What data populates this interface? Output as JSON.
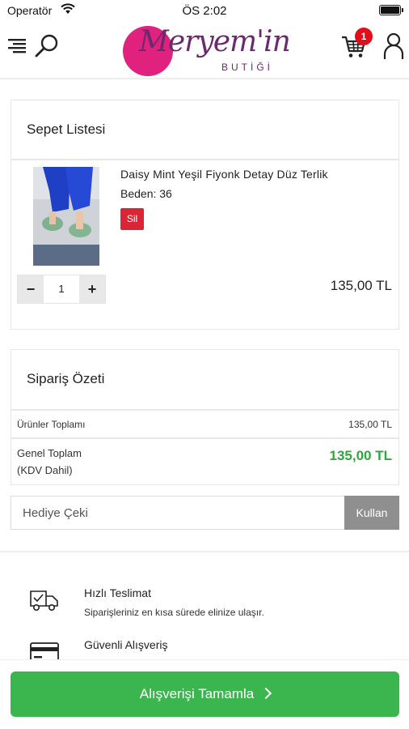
{
  "status_bar": {
    "carrier": "Operatör",
    "time": "ÖS 2:02"
  },
  "header": {
    "logo_script": "Meryem'in",
    "logo_sub": "BUTİĞİ",
    "cart_count": "1",
    "colors": {
      "brand_pink": "#e0227e",
      "brand_purple": "#6b2a6d",
      "badge": "#e10f1b"
    }
  },
  "cart": {
    "title": "Sepet Listesi",
    "items": [
      {
        "name": "Daisy Mint Yeşil Fiyonk Detay Düz Terlik",
        "size": "Beden: 36",
        "delete_label": "Sil",
        "quantity": "1",
        "decrement": "−",
        "increment": "+",
        "price": "135,00 TL"
      }
    ]
  },
  "summary": {
    "title": "Sipariş Özeti",
    "products_total_label": "Ürünler Toplamı",
    "products_total_value": "135,00 TL",
    "grand_total_label": "Genel Toplam",
    "grand_total_note": "(KDV Dahil)",
    "grand_total_value": "135,00 TL"
  },
  "coupon": {
    "placeholder": "Hediye Çeki",
    "button_label": "Kullan"
  },
  "info": [
    {
      "icon": "delivery-icon",
      "title": "Hızlı Teslimat",
      "text": "Siparişleriniz en kısa sürede elinize ulaşır."
    },
    {
      "icon": "credit-card-icon",
      "title": "Güvenli Alışveriş",
      "text": ""
    }
  ],
  "checkout": {
    "label": "Alışverişi Tamamla",
    "color": "#3bb54d"
  }
}
